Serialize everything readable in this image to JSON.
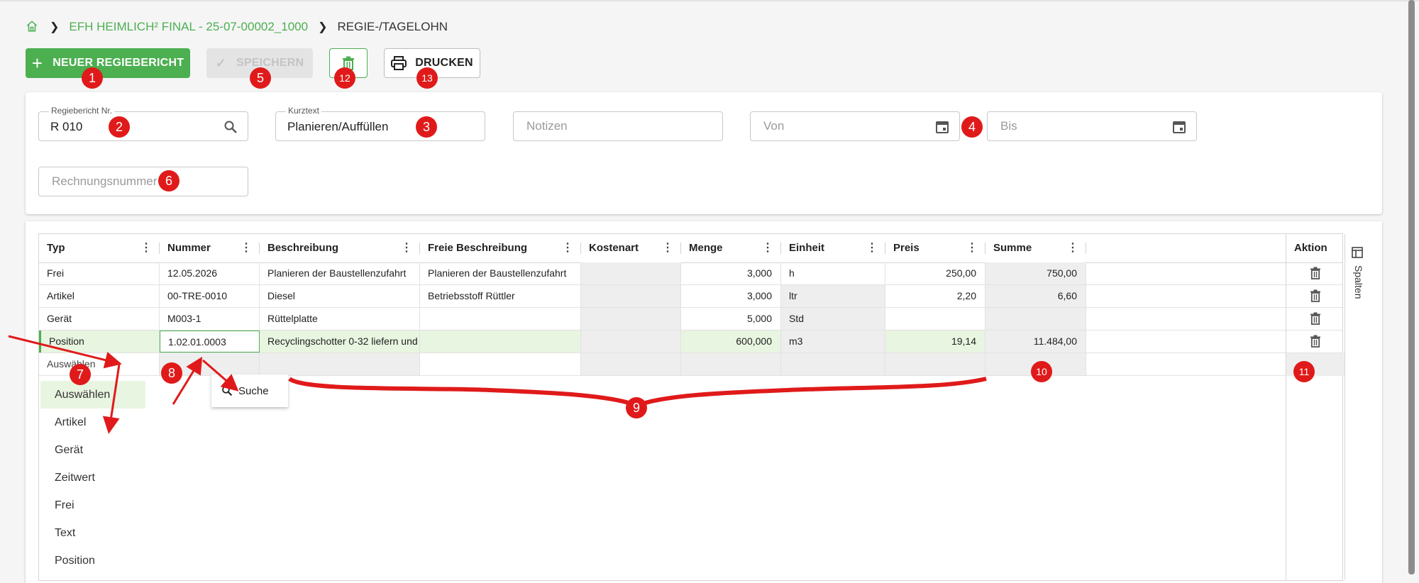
{
  "breadcrumb": {
    "project": "EFH HEIMLICH² FINAL - 25-07-00002_1000",
    "current": "REGIE-/TAGELOHN"
  },
  "toolbar": {
    "new_label": "NEUER REGIEBERICHT",
    "save_label": "SPEICHERN",
    "print_label": "DRUCKEN"
  },
  "form": {
    "regiebericht": {
      "label": "Regiebericht Nr.",
      "value": "R  010"
    },
    "kurztext": {
      "label": "Kurztext",
      "value": "Planieren/Auffüllen"
    },
    "notizen": {
      "placeholder": "Notizen"
    },
    "von": {
      "placeholder": "Von"
    },
    "bis": {
      "placeholder": "Bis"
    },
    "rechnungsnummer": {
      "placeholder": "Rechnungsnummer"
    }
  },
  "grid": {
    "columns": [
      "Typ",
      "Nummer",
      "Beschreibung",
      "Freie Beschreibung",
      "Kostenart",
      "Menge",
      "Einheit",
      "Preis",
      "Summe"
    ],
    "action_header": "Aktion",
    "side_label": "Spalten",
    "rows": [
      {
        "typ": "Frei",
        "nummer": "12.05.2026",
        "beschreibung": "Planieren der Baustellenzufahrt",
        "freie": "Planieren der Baustellenzufahrt",
        "kostenart": "",
        "menge": "3,000",
        "einheit": "h",
        "preis": "250,00",
        "summe": "750,00"
      },
      {
        "typ": "Artikel",
        "nummer": "00-TRE-0010",
        "beschreibung": "Diesel",
        "freie": "Betriebsstoff Rüttler",
        "kostenart": "",
        "menge": "3,000",
        "einheit": "ltr",
        "preis": "2,20",
        "summe": "6,60"
      },
      {
        "typ": "Gerät",
        "nummer": "M003-1",
        "beschreibung": "Rüttelplatte",
        "freie": "",
        "kostenart": "",
        "menge": "5,000",
        "einheit": "Std",
        "preis": "",
        "summe": ""
      },
      {
        "typ": "Position",
        "nummer": "1.02.01.0003",
        "beschreibung": "Recyclingschotter 0-32 liefern und",
        "freie": "",
        "kostenart": "",
        "menge": "600,000",
        "einheit": "m3",
        "preis": "19,14",
        "summe": "11.484,00"
      },
      {
        "typ": "Auswählen",
        "nummer": "",
        "beschreibung": "",
        "freie": "",
        "kostenart": "",
        "menge": "",
        "einheit": "",
        "preis": "",
        "summe": ""
      }
    ]
  },
  "type_dropdown": {
    "options": [
      "Auswählen",
      "Artikel",
      "Gerät",
      "Zeitwert",
      "Frei",
      "Text",
      "Position"
    ]
  },
  "search_popup": {
    "label": "Suche"
  },
  "markers": [
    "1",
    "2",
    "3",
    "4",
    "5",
    "6",
    "7",
    "8",
    "9",
    "10",
    "11",
    "12",
    "13"
  ],
  "colors": {
    "accent": "#4caf50",
    "marker": "#e01a1a",
    "selected_row": "#e8f5e0"
  }
}
